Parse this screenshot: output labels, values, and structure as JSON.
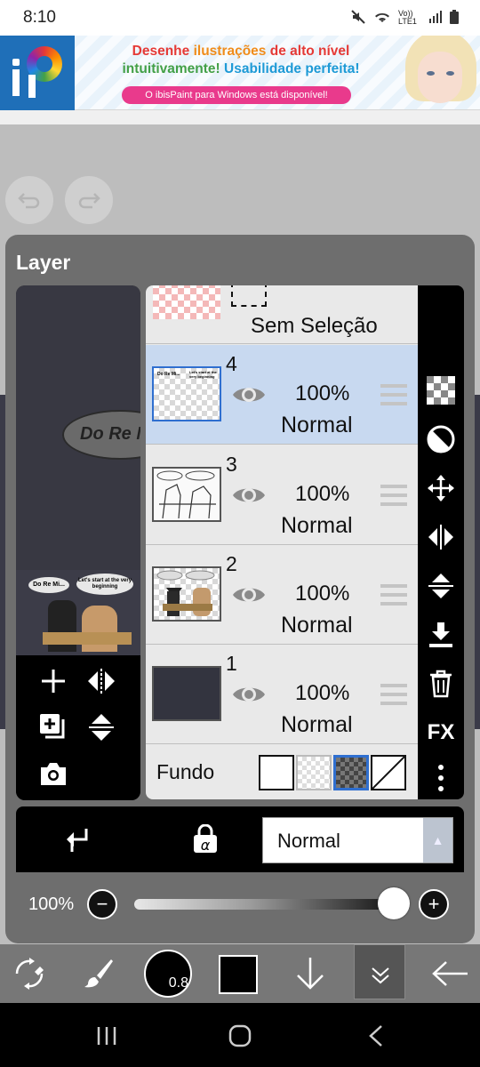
{
  "status_bar": {
    "time": "8:10",
    "network": "Vo)) LTE1"
  },
  "ad": {
    "line1_a": "Desenhe ",
    "line1_b": "ilustrações",
    "line1_c": " de alto nível",
    "line2_a": "intuitivamente! ",
    "line2_b": "Usabilidade perfeita!",
    "pill": "O ibisPaint para Windows está disponível!"
  },
  "canvas": {
    "bubble_text": "Do Re M"
  },
  "layer_panel": {
    "title": "Layer",
    "thumb_bubble1": "Do Re Mi...",
    "thumb_bubble2": "Let's start at the very beginning",
    "selection_label": "Sem Seleção",
    "layers": [
      {
        "number": "4",
        "opacity": "100%",
        "blend": "Normal",
        "active": true,
        "visible": true
      },
      {
        "number": "3",
        "opacity": "100%",
        "blend": "Normal",
        "active": false,
        "visible": true
      },
      {
        "number": "2",
        "opacity": "100%",
        "blend": "Normal",
        "active": false,
        "visible": true
      },
      {
        "number": "1",
        "opacity": "100%",
        "blend": "Normal",
        "active": false,
        "visible": true
      }
    ],
    "background_label": "Fundo",
    "fx_label": "FX",
    "blend_mode": "Normal",
    "opacity_label": "100%",
    "opacity_value": 1.0
  },
  "toolbar": {
    "brush_size": "0.8"
  },
  "colors": {
    "active_layer": "#c8d9f0",
    "panel": "#6e6e6e",
    "accent": "#2f6fd0"
  }
}
